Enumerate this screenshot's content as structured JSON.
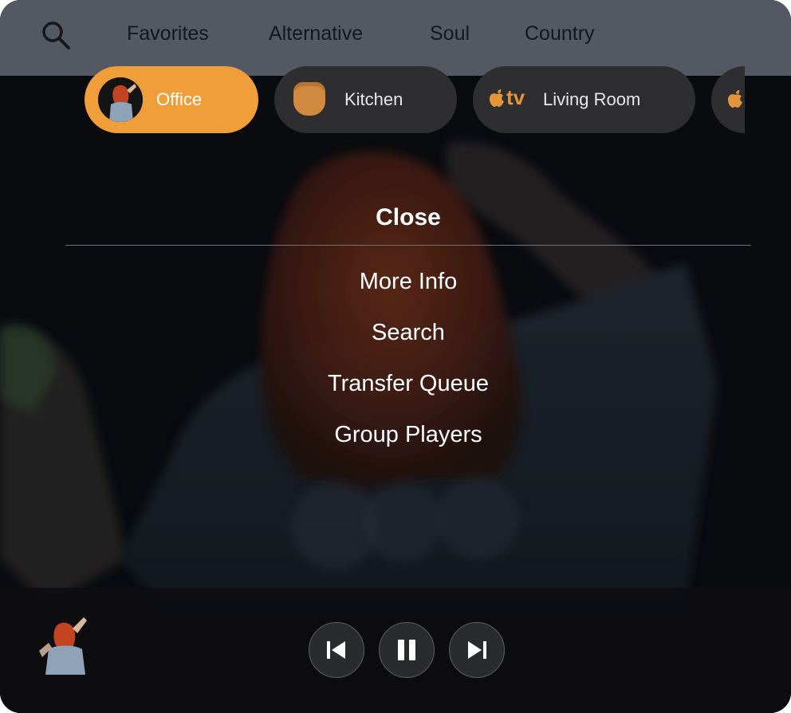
{
  "topbar": {
    "search_icon": "magnifier-icon",
    "categories": [
      "Favorites",
      "Alternative",
      "Soul",
      "Country"
    ]
  },
  "players": [
    {
      "label": "Office",
      "icon": "album-art-avatar",
      "active": true
    },
    {
      "label": "Kitchen",
      "icon": "homepod-icon",
      "active": false
    },
    {
      "label": "Living Room",
      "icon": "apple-tv-icon",
      "icon_text": "tv",
      "active": false
    },
    {
      "label": "",
      "icon": "apple-logo-icon",
      "active": false
    }
  ],
  "menu": {
    "close": "Close",
    "items": [
      "More Info",
      "Search",
      "Transfer Queue",
      "Group Players"
    ]
  },
  "transport": {
    "previous_icon": "skip-back-icon",
    "pause_icon": "pause-icon",
    "next_icon": "skip-forward-icon"
  },
  "colors": {
    "accent": "#f09e3a",
    "topbar": "#545862",
    "pill": "#2e2e30",
    "background": "#0b0d12"
  }
}
